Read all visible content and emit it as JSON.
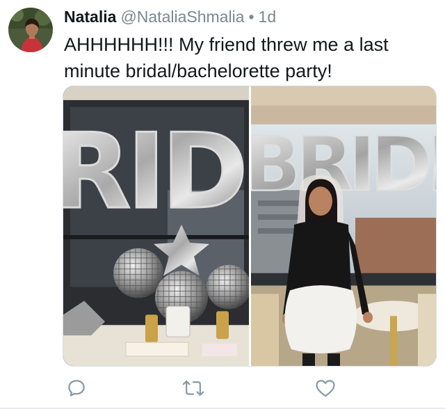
{
  "tweet": {
    "display_name": "Natalia",
    "handle": "@NataliaShmalia",
    "separator": "•",
    "time": "1d",
    "text": "AHHHHHH!!! My friend threw me a last minute bridal/bachelorette party!"
  },
  "media": {
    "left_balloon_letters": "RID",
    "right_balloon_letters": "BRIDE"
  },
  "actions": {
    "reply_icon": "reply-icon",
    "retweet_icon": "retweet-icon",
    "like_icon": "heart-icon"
  },
  "colors": {
    "text": "#14171a",
    "secondary": "#7a8791",
    "icon": "#8899a6",
    "border": "#d8dee3"
  }
}
